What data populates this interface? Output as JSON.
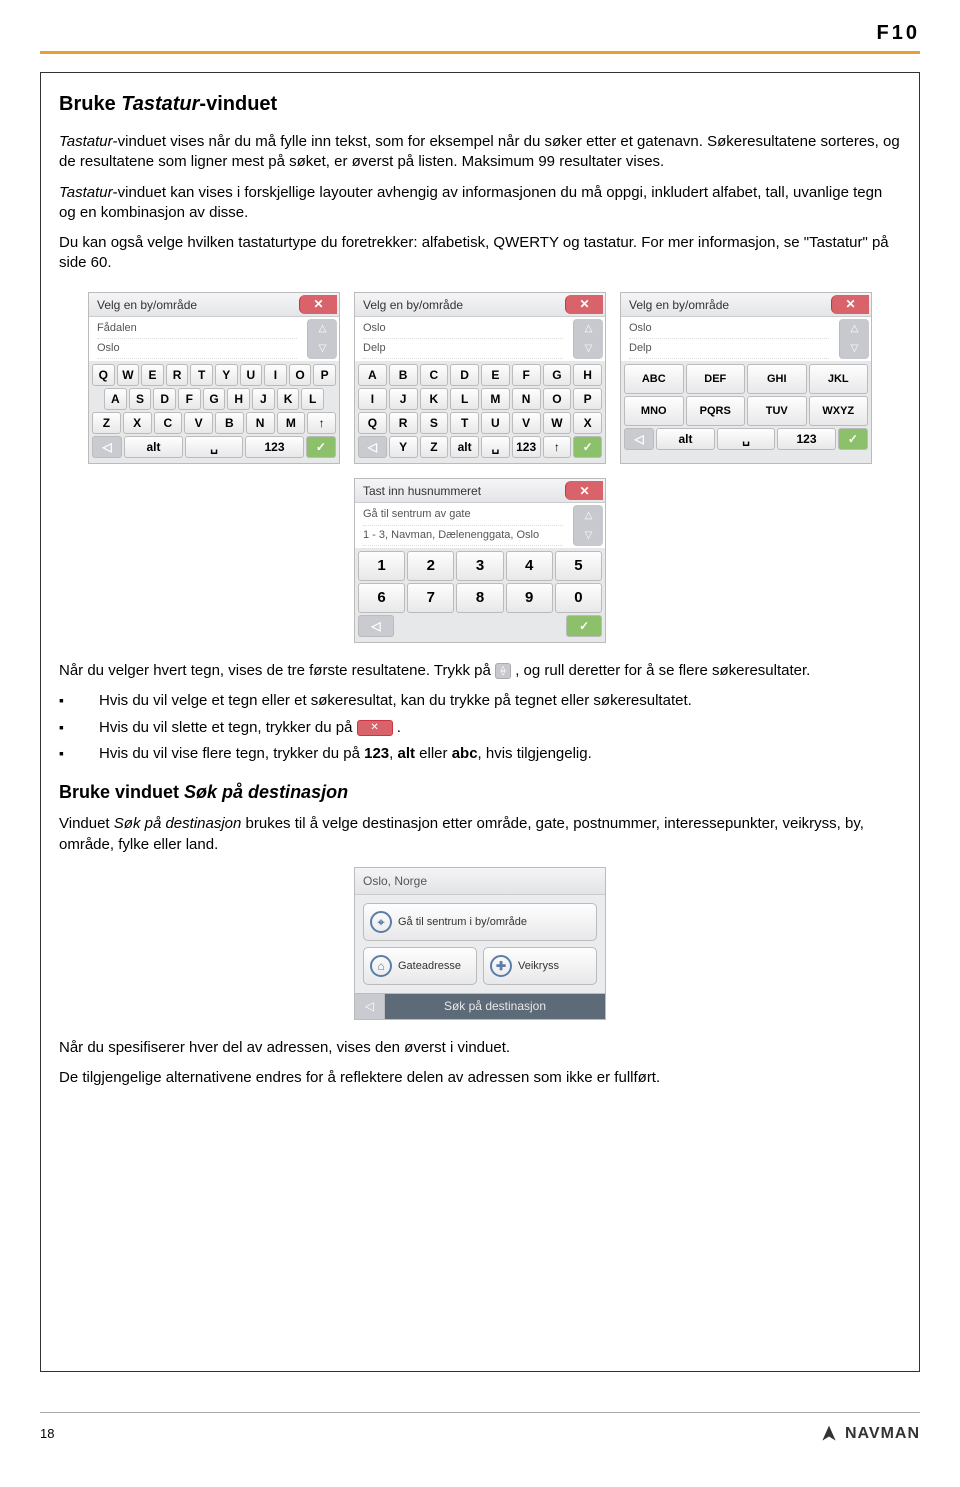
{
  "header": {
    "model": "F10"
  },
  "title": {
    "prefix": "Bruke ",
    "italic": "Tastatur",
    "suffix": "-vinduet"
  },
  "paras": {
    "p1a": "Tastatur",
    "p1b": "-vinduet vises når du må fylle inn tekst, som for eksempel når du søker etter et gatenavn. Søkeresultatene sorteres, og de resultatene som ligner mest på søket, er øverst på listen. Maksimum 99 resultater vises.",
    "p2a": "Tastatur",
    "p2b": "-vinduet kan vises i forskjellige layouter avhengig av informasjonen du må oppgi, inkludert alfabet, tall, uvanlige tegn og en kombinasjon av disse.",
    "p3": "Du kan også velge hvilken tastaturtype du foretrekker: alfabetisk, QWERTY og tastatur. For mer informasjon, se \"Tastatur\" på side 60.",
    "p4a": "Når du velger hvert tegn, vises de tre første resultatene. Trykk på ",
    "p4b": ", og rull deretter for å se flere søkeresultater."
  },
  "bullets": {
    "b1": "Hvis du vil velge et tegn eller et søkeresultat, kan du trykke på tegnet eller søkeresultatet.",
    "b2a": "Hvis du vil slette et tegn, trykker du på ",
    "b2b": ".",
    "b3a": "Hvis du vil vise flere tegn, trykker du på ",
    "b3_123": "123",
    "b3_mid1": ", ",
    "b3_alt": "alt",
    "b3_mid2": " eller ",
    "b3_abc": "abc",
    "b3b": ", hvis tilgjengelig."
  },
  "sub": {
    "prefix": "Bruke vinduet ",
    "italic": "Søk på destinasjon"
  },
  "p5a": "Vinduet ",
  "p5ital": "Søk på destinasjon",
  "p5b": " brukes til å velge destinasjon etter område, gate, postnummer, interessepunkter, veikryss, by, område, fylke eller land.",
  "p6": "Når du spesifiserer hver del av adressen, vises den øverst i vinduet.",
  "p7": "De tilgjengelige alternativene endres for å reflektere delen av adressen som ikke er fullført.",
  "kb": {
    "header_area": "Velg en by/område",
    "header_num": "Tast inn husnummeret",
    "res_qwerty": [
      "Fådalen",
      "Oslo"
    ],
    "res_abc": [
      "Oslo",
      "Delp"
    ],
    "res_group": [
      "Oslo",
      "Delp"
    ],
    "res_num": [
      "Gå til sentrum av gate",
      "1 - 3, Navman, Dælenenggata, Oslo"
    ],
    "alt": "alt",
    "n123": "123",
    "abc": "ABC",
    "groups": [
      "ABC",
      "DEF",
      "GHI",
      "JKL",
      "MNO",
      "PQRS",
      "TUV",
      "WXYZ"
    ]
  },
  "dest": {
    "head": "Oslo, Norge",
    "btn1": "Gå til sentrum i by/område",
    "btn2": "Gateadresse",
    "btn3": "Veikryss",
    "foot": "Søk på destinasjon"
  },
  "footer": {
    "pagenum": "18",
    "brand": "NAVMAN"
  }
}
